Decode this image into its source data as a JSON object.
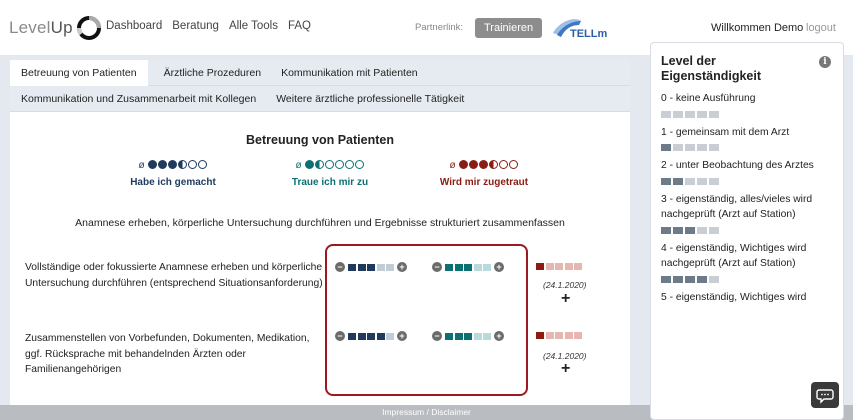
{
  "header": {
    "logo_text_light": "Level",
    "logo_text_dark": "Up",
    "nav": [
      "Dashboard",
      "Beratung",
      "Alle Tools",
      "FAQ"
    ],
    "partner_label": "Partnerlink:",
    "trainieren_label": "Trainieren",
    "tellme_logo_text": "TELLme",
    "welcome": "Willkommen Demo",
    "logout": "logout"
  },
  "tabs": {
    "row1": [
      "Betreuung von Patienten",
      "Ärztliche Prozeduren",
      "Kommunikation mit Patienten"
    ],
    "row2": [
      "Kommunikation und Zusammenarbeit mit Kollegen",
      "Weitere ärztliche professionelle Tätigkeit"
    ],
    "active": "Betreuung von Patienten"
  },
  "section_title": "Betreuung von Patienten",
  "legend": [
    {
      "symbol": "ø",
      "label": "Habe ich gemacht",
      "color": "#1f3a5c",
      "dots": [
        "full",
        "full",
        "full",
        "half",
        "empty",
        "empty"
      ]
    },
    {
      "symbol": "ø",
      "label": "Traue ich mir zu",
      "color": "#0c6f72",
      "dots": [
        "full",
        "half",
        "empty",
        "empty",
        "empty",
        "empty"
      ]
    },
    {
      "symbol": "ø",
      "label": "Wird mir zugetraut",
      "color": "#8b1c14",
      "dots": [
        "full",
        "full",
        "full",
        "half",
        "empty",
        "empty"
      ]
    }
  ],
  "instruction": "Anamnese erheben, körperliche Untersuchung durchführen und Ergebnisse strukturiert zusammenfassen",
  "items": [
    {
      "text": "Vollständige oder fokussierte Anamnese erheben und körperliche Untersuchung durchführen (entsprechend Situationsanforderung)",
      "gemacht_level": 3,
      "zutrauen_level": 3,
      "zugetraut_level": 1,
      "date": "(24.1.2020)"
    },
    {
      "text": "Zusammenstellen von Vorbefunden, Dokumenten, Medikation, ggf. Rücksprache mit behandelnden Ärzten oder Familienangehörigen",
      "gemacht_level": 4,
      "zutrauen_level": 3,
      "zugetraut_level": 1,
      "date": "(24.1.2020)"
    }
  ],
  "footer": "Impressum / Disclaimer",
  "side": {
    "title": "Level der Eigenständigkeit",
    "levels": [
      {
        "label": "0 - keine Ausführung",
        "filled": 0
      },
      {
        "label": "1 - gemeinsam mit dem Arzt",
        "filled": 1
      },
      {
        "label": "2 - unter Beobachtung des Arztes",
        "filled": 2
      },
      {
        "label": "3 - eigenständig, alles/vieles wird nachgeprüft (Arzt auf Station)",
        "filled": 3
      },
      {
        "label": "4 - eigenständig, Wichtiges wird nachgeprüft (Arzt auf Station)",
        "filled": 4
      },
      {
        "label": "5 - eigenständig, Wichtiges wird",
        "filled": 5
      }
    ]
  },
  "colors": {
    "navy": "#1f3a5c",
    "teal": "#0c6f72",
    "red": "#8b1c14",
    "highlight": "#9b1a20"
  }
}
